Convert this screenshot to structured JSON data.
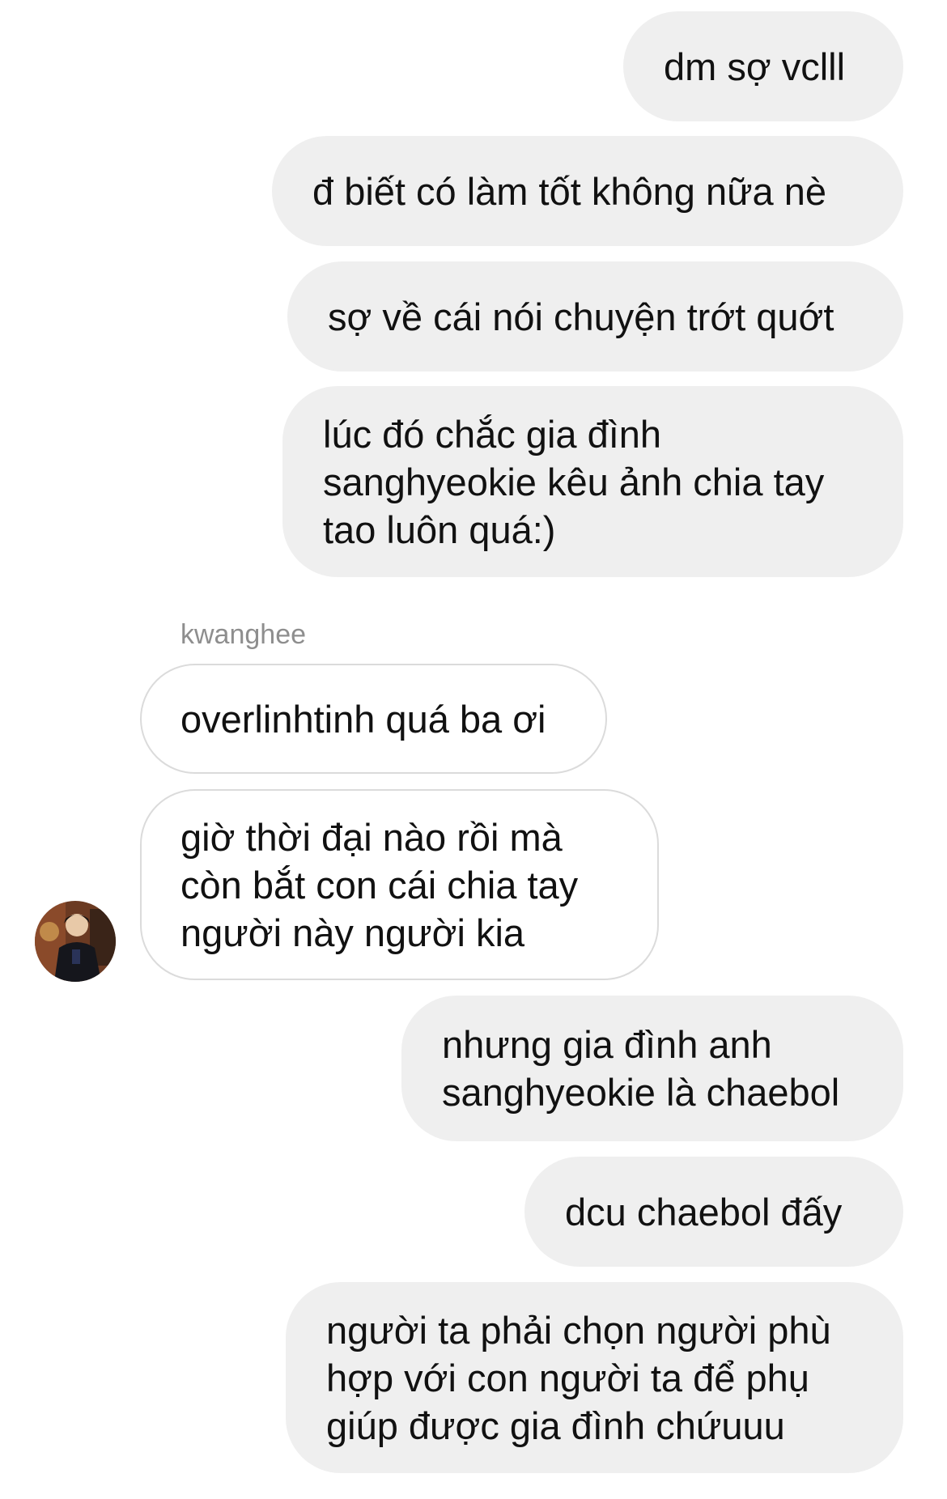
{
  "conversation": {
    "sender_name": "kwanghee",
    "messages": [
      {
        "from": "me",
        "lines": [
          "dm sợ vclll"
        ]
      },
      {
        "from": "me",
        "lines": [
          "đ biết có làm tốt không nữa nè"
        ]
      },
      {
        "from": "me",
        "lines": [
          "sợ về cái nói chuyện trớt quớt"
        ]
      },
      {
        "from": "me",
        "lines": [
          "lúc đó chắc gia đình",
          "sanghyeokie kêu ảnh chia tay",
          "tao luôn quá:)"
        ]
      },
      {
        "from": "kwanghee",
        "lines": [
          "overlinhtinh quá ba ơi"
        ]
      },
      {
        "from": "kwanghee",
        "lines": [
          "giờ thời đại nào rồi mà",
          "còn bắt con cái chia tay",
          "người này người kia"
        ]
      },
      {
        "from": "me",
        "lines": [
          "nhưng gia đình anh",
          "sanghyeokie là chaebol"
        ]
      },
      {
        "from": "me",
        "lines": [
          "dcu chaebol đấy"
        ]
      },
      {
        "from": "me",
        "lines": [
          "người ta phải chọn người phù",
          "hợp với con người ta để phụ",
          "giúp được gia đình chứuuu"
        ]
      }
    ]
  },
  "avatar": {
    "icon": "user-photo-avatar"
  }
}
